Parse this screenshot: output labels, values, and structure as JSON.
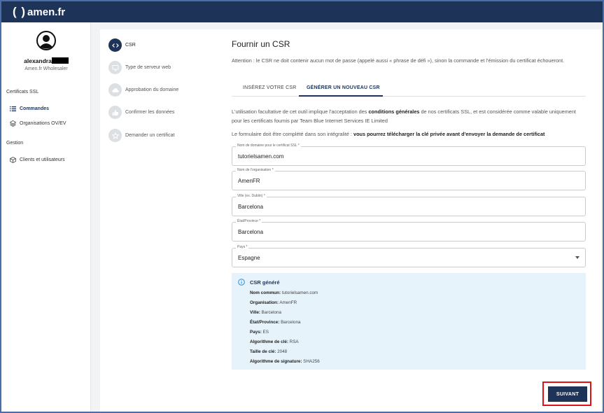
{
  "brand": {
    "name": "amen.fr",
    "paren": "( )"
  },
  "user": {
    "name": "alexandra",
    "company": "Amen.fr Wholesaler"
  },
  "sidebar": {
    "section_ssl": "Certificats SSL",
    "commandes": "Commandes",
    "organisations": "Organisations OV/EV",
    "section_gestion": "Gestion",
    "clients": "Clients et utilisateurs"
  },
  "steps": [
    {
      "label": "CSR",
      "icon": "code-icon"
    },
    {
      "label": "Type de serveur web",
      "icon": "monitor-icon"
    },
    {
      "label": "Approbation du domaine",
      "icon": "cloud-icon"
    },
    {
      "label": "Confirmer les données",
      "icon": "thumb-up-icon"
    },
    {
      "label": "Demander un certificat",
      "icon": "star-icon"
    }
  ],
  "main": {
    "title": "Fournir un CSR",
    "warning": "Attention : le CSR ne doit contenir aucun mot de passe (appelé aussi « phrase de défi »), sinon la commande et l'émission du certificat échoueront.",
    "tab_insert": "INSÉREZ VOTRE CSR",
    "tab_generate": "GÉNÉRER UN NOUVEAU CSR",
    "terms_pre": "L'utilisation facultative de cet outil implique l'acceptation des ",
    "terms_bold": "conditions générales",
    "terms_post": " de nos certificats SSL, et est considérée comme valable uniquement pour les certificats fournis par Team Blue Internet Services IE Limited",
    "form_note_pre": "Le formulaire doit être complété dans son intégralité : ",
    "form_note_bold": "vous pourrez télécharger la clé privée avant d'envoyer la demande de certificat"
  },
  "fields": {
    "domain": {
      "label": "Nom de domaine pour le certificat SSL *",
      "value": "tutorielsamen.com"
    },
    "org": {
      "label": "Nom de l'organisation *",
      "value": "AmenFR"
    },
    "city": {
      "label": "Ville (ex. Dublin) *",
      "value": "Barcelona"
    },
    "state": {
      "label": "État/Province *",
      "value": "Barcelona"
    },
    "country": {
      "label": "Pays *",
      "value": "Espagne"
    }
  },
  "csr": {
    "title": "CSR généré",
    "rows": [
      {
        "k": "Nom commun:",
        "v": " tutorielsamen.com"
      },
      {
        "k": "Organisation:",
        "v": " AmenFR"
      },
      {
        "k": "Ville:",
        "v": " Barcelona"
      },
      {
        "k": "État/Province:",
        "v": " Barcelona"
      },
      {
        "k": "Pays:",
        "v": " ES"
      },
      {
        "k": "Algorithme de clé:",
        "v": " RSA"
      },
      {
        "k": "Taille de clé:",
        "v": " 2048"
      },
      {
        "k": "Algorithme de signature:",
        "v": " SHA256"
      }
    ]
  },
  "next_label": "SUIVANT"
}
